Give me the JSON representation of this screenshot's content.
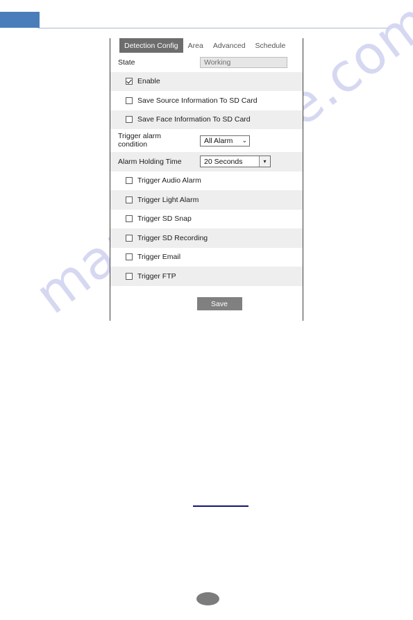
{
  "watermark": {
    "text": "manualshive.com"
  },
  "panel": {
    "tabs": [
      {
        "label": "Detection Config",
        "active": true
      },
      {
        "label": "Area",
        "active": false
      },
      {
        "label": "Advanced",
        "active": false
      },
      {
        "label": "Schedule",
        "active": false
      }
    ],
    "state_row": {
      "label": "State",
      "value": "Working"
    },
    "rows": [
      {
        "type": "checkbox",
        "label": "Enable",
        "checked": true,
        "shaded": true
      },
      {
        "type": "checkbox",
        "label": "Save Source Information To SD Card",
        "checked": false,
        "shaded": false
      },
      {
        "type": "checkbox",
        "label": "Save Face Information To SD Card",
        "checked": false,
        "shaded": true
      },
      {
        "type": "select_a",
        "label": "Trigger alarm condition",
        "value": "All Alarm",
        "shaded": false
      },
      {
        "type": "select_b",
        "label": "Alarm Holding Time",
        "value": "20 Seconds",
        "shaded": true
      },
      {
        "type": "checkbox",
        "label": "Trigger Audio Alarm",
        "checked": false,
        "shaded": false
      },
      {
        "type": "checkbox",
        "label": "Trigger Light Alarm",
        "checked": false,
        "shaded": true
      },
      {
        "type": "checkbox",
        "label": "Trigger SD Snap",
        "checked": false,
        "shaded": false
      },
      {
        "type": "checkbox",
        "label": "Trigger SD Recording",
        "checked": false,
        "shaded": true
      },
      {
        "type": "checkbox",
        "label": "Trigger Email",
        "checked": false,
        "shaded": false
      },
      {
        "type": "checkbox",
        "label": "Trigger FTP",
        "checked": false,
        "shaded": true
      }
    ],
    "save_label": "Save",
    "trigger_alarm_label_line1": "Trigger alarm",
    "trigger_alarm_label_line2": "condition",
    "chevron_down_glyph": "⌄",
    "caret_down_glyph": "▾"
  },
  "colors": {
    "header_band": "#4a7ebb",
    "header_rule": "#a9bcd0",
    "active_tab": "#6d6d6d",
    "row_shaded": "#eeeeee",
    "save_button": "#808080",
    "watermark": "#c9cbee",
    "footer_link": "#13137a",
    "page_badge": "#7c7c7c"
  }
}
